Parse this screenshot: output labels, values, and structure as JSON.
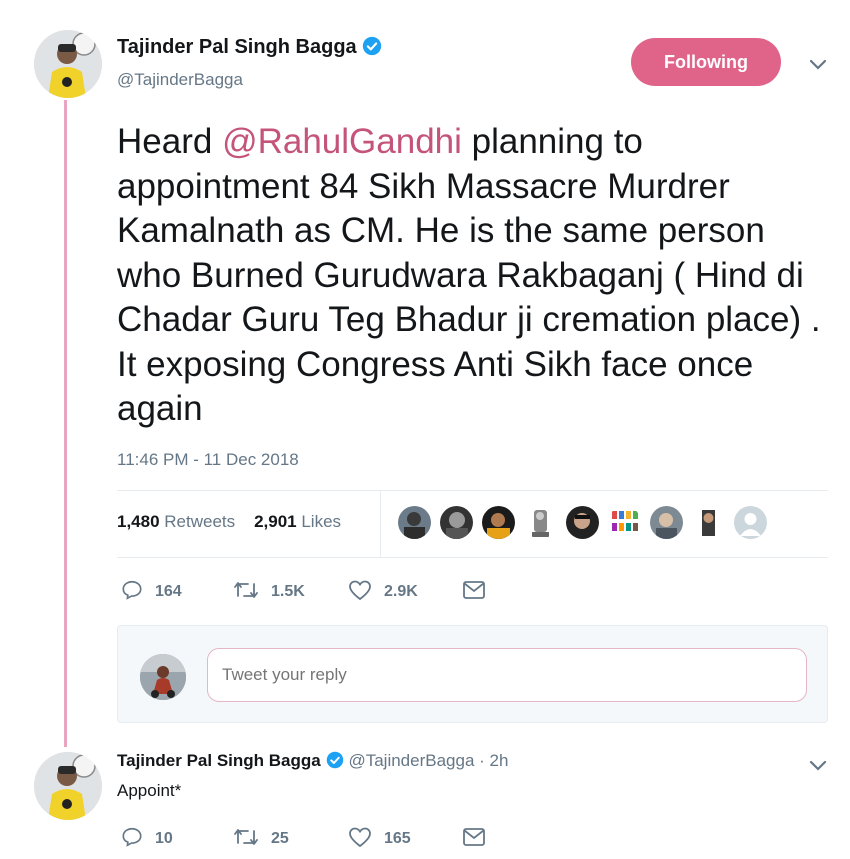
{
  "tweet": {
    "author_name": "Tajinder Pal Singh Bagga",
    "author_handle": "@TajinderBagga",
    "follow_label": "Following",
    "text_before": "Heard ",
    "mention": "@RahulGandhi",
    "text_after": " planning to appointment 84 Sikh Massacre Murdrer Kamalnath as CM. He is the same person who Burned Gurudwara Rakbaganj ( Hind di Chadar Guru Teg Bhadur ji cremation place) . It exposing Congress Anti Sikh face once again",
    "timestamp": "11:46 PM - 11 Dec 2018",
    "retweets_count": "1,480",
    "retweets_label": "Retweets",
    "likes_count": "2,901",
    "likes_label": "Likes",
    "actions": {
      "reply_count": "164",
      "retweet_count": "1.5K",
      "like_count": "2.9K"
    }
  },
  "reply_box": {
    "placeholder": "Tweet your reply"
  },
  "reply": {
    "author_name": "Tajinder Pal Singh Bagga",
    "author_handle": "@TajinderBagga",
    "time": "· 2h",
    "text": "Appoint*",
    "actions": {
      "reply_count": "10",
      "retweet_count": "25",
      "like_count": "165"
    }
  },
  "colors": {
    "accent": "#e0638a",
    "mention": "#c4547a",
    "verified": "#1da1f2",
    "thread_line": "#e8a5c0",
    "secondary_text": "#657786"
  }
}
